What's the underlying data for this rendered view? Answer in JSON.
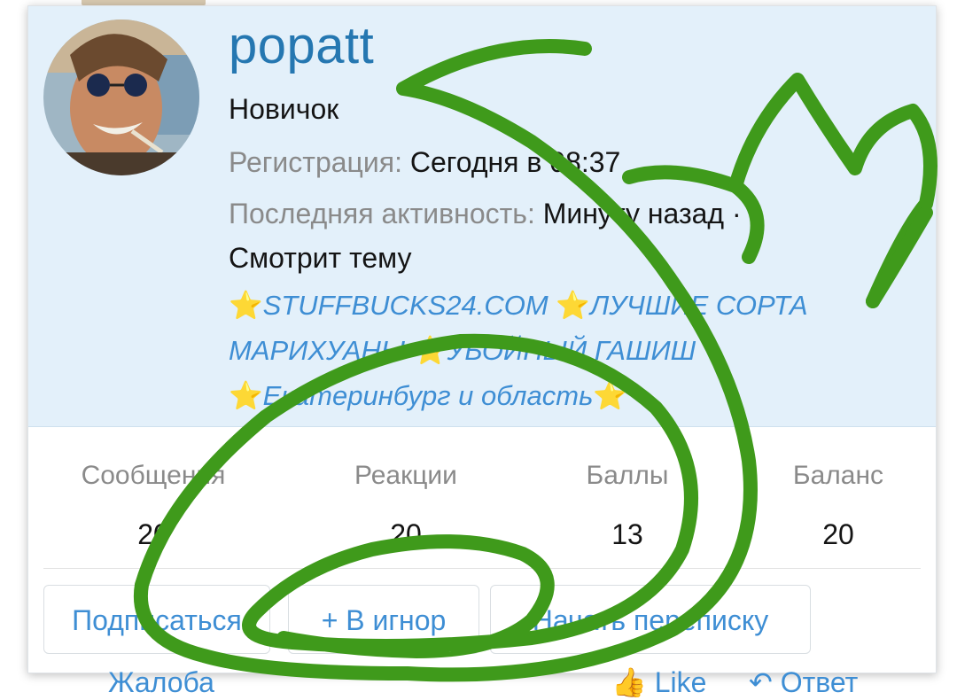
{
  "profile": {
    "username": "popatt",
    "user_title": "Новичок",
    "registration_label": "Регистрация:",
    "registration_value": "Сегодня в 08:37",
    "activity_label": "Последняя активность:",
    "activity_value": "Минуту назад ·",
    "viewing_label": "Смотрит тему",
    "thread_title_parts": [
      "STUFFBUCKS24.COM",
      "ЛУЧШИЕ СОРТА МАРИХУАНЫ",
      "УБОЙНЫЙ ГАШИШ",
      "Екатеринбург и область"
    ],
    "star_glyph": "⭐"
  },
  "stats": [
    {
      "label": "Сообщения",
      "value": "20"
    },
    {
      "label": "Реакции",
      "value": "20"
    },
    {
      "label": "Баллы",
      "value": "13"
    },
    {
      "label": "Баланс",
      "value": "20"
    }
  ],
  "actions": {
    "follow_label": "Подписаться",
    "ignore_label": "+ В игнор",
    "conversation_label": "Начать переписку"
  },
  "footer": {
    "report_label": "Жалоба",
    "like_label": "Like",
    "reply_label": "Ответ"
  },
  "colors": {
    "accent": "#2577b1",
    "link": "#3e8ed4",
    "header_bg": "#e3f0fa",
    "scribble": "#3f9a1b"
  },
  "icons": {
    "like": "thumbs-up-icon",
    "reply": "reply-arrow-icon"
  }
}
